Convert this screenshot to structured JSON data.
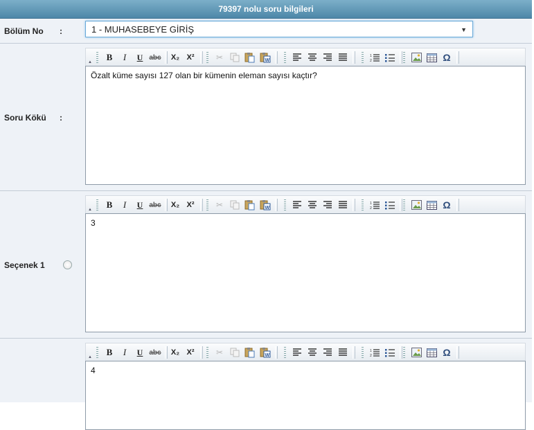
{
  "header": {
    "title": "79397 nolu soru bilgileri"
  },
  "bolum": {
    "label": "Bölüm No",
    "colon": ":",
    "selected": "1 - MUHASEBEYE GİRİŞ"
  },
  "soru_koku": {
    "label": "Soru Kökü",
    "colon": ":",
    "text": "Özalt küme sayısı 127 olan bir kümenin eleman sayısı kaçtır?"
  },
  "secenek1": {
    "label": "Seçenek 1",
    "text": "3"
  },
  "secenek2": {
    "label": "",
    "text": "4"
  },
  "toolbar_labels": {
    "bold": "B",
    "italic": "I",
    "underline": "U",
    "strike": "abc",
    "subscript": "X₂",
    "superscript": "X²",
    "special": "Ω"
  }
}
